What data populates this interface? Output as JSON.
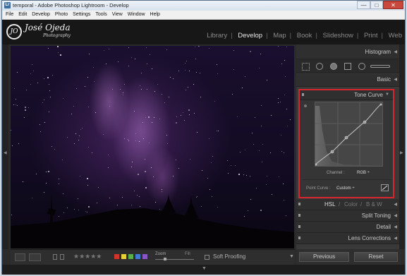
{
  "window": {
    "title": "temporal - Adobe Photoshop Lightroom - Develop",
    "app_icon": "Lr",
    "min": "—",
    "max": "□",
    "close": "✕"
  },
  "menubar": [
    "File",
    "Edit",
    "Develop",
    "Photo",
    "Settings",
    "Tools",
    "View",
    "Window",
    "Help"
  ],
  "identity_plate": {
    "badge_text": "JO",
    "name": "José Ojeda",
    "subtitle": "Photography"
  },
  "modules": [
    "Library",
    "Develop",
    "Map",
    "Book",
    "Slideshow",
    "Print",
    "Web"
  ],
  "active_module": "Develop",
  "right_panel": {
    "histogram": "Histogram",
    "basic": "Basic",
    "tone_curve": {
      "title": "Tone Curve",
      "channel_label": "Channel :",
      "channel_value": "RGB ÷",
      "point_curve_label": "Point Curve :",
      "point_curve_value": "Custom ÷"
    },
    "hsl": {
      "hsl": "HSL",
      "slash1": "/",
      "color": "Color",
      "slash2": "/",
      "bw": "B & W"
    },
    "split_toning": "Split Toning",
    "detail": "Detail",
    "lens_corrections": "Lens Corrections"
  },
  "toolbar": {
    "stars": "★★★★★",
    "zoom_label": "Zoom",
    "fill_label": "Fill",
    "soft_proofing": "Soft Proofing",
    "dropdown": "▼"
  },
  "buttons": {
    "previous": "Previous",
    "reset": "Reset"
  },
  "colors": {
    "accent_red": "#d9262c",
    "swatches": [
      "#d0342c",
      "#e4d43a",
      "#56b14a",
      "#3e7bd4",
      "#8a55c8"
    ]
  }
}
